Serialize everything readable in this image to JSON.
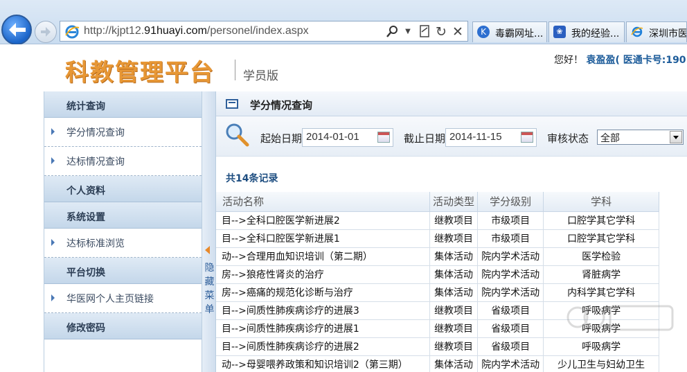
{
  "browser": {
    "url_prefix": "http://kjpt12.",
    "url_domain": "91huayi.com",
    "url_path": "/personel/index.aspx",
    "tabs": [
      {
        "label": "毒霸网址...",
        "icon": "k-icon",
        "color": "#2d6fd0"
      },
      {
        "label": "我的经验...",
        "icon": "paw-icon",
        "color": "#2a5fc0"
      },
      {
        "label": "深圳市医",
        "icon": "ie-icon",
        "color": "#1e7fd8"
      }
    ]
  },
  "header": {
    "logo": "科教管理平台",
    "edition": "学员版",
    "greeting_prefix": "您好！",
    "user_text": "袁盈盈( 医通卡号:190"
  },
  "sidebar": {
    "items": [
      {
        "type": "section",
        "label": "统计查询"
      },
      {
        "type": "item",
        "label": "学分情况查询"
      },
      {
        "type": "item",
        "label": "达标情况查询"
      },
      {
        "type": "section",
        "label": "个人资料"
      },
      {
        "type": "section",
        "label": "系统设置"
      },
      {
        "type": "item",
        "label": "达标标准浏览"
      },
      {
        "type": "section",
        "label": "平台切换"
      },
      {
        "type": "item",
        "label": "华医网个人主页链接"
      },
      {
        "type": "section",
        "label": "修改密码"
      }
    ],
    "toggle_label": "隐藏菜单"
  },
  "main": {
    "title": "学分情况查询",
    "filters": {
      "start_label": "起始日期",
      "start_value": "2014-01-01",
      "end_label": "截止日期",
      "end_value": "2014-11-15",
      "status_label": "审核状态",
      "status_value": "全部"
    },
    "record_count": "共14条记录",
    "columns": [
      "活动名称",
      "活动类型",
      "学分级别",
      "学科"
    ],
    "rows": [
      [
        "目-->全科口腔医学新进展2",
        "继教项目",
        "市级项目",
        "口腔学其它学科"
      ],
      [
        "目-->全科口腔医学新进展1",
        "继教项目",
        "市级项目",
        "口腔学其它学科"
      ],
      [
        "动-->合理用血知识培训（第二期）",
        "集体活动",
        "院内学术活动",
        "医学检验"
      ],
      [
        "房-->狼疮性肾炎的治疗",
        "集体活动",
        "院内学术活动",
        "肾脏病学"
      ],
      [
        "房-->癌痛的规范化诊断与治疗",
        "集体活动",
        "院内学术活动",
        "内科学其它学科"
      ],
      [
        "目-->间质性肺疾病诊疗的进展3",
        "继教项目",
        "省级项目",
        "呼吸病学"
      ],
      [
        "目-->间质性肺疾病诊疗的进展1",
        "继教项目",
        "省级项目",
        "呼吸病学"
      ],
      [
        "目-->间质性肺疾病诊疗的进展2",
        "继教项目",
        "省级项目",
        "呼吸病学"
      ],
      [
        "动-->母婴喂养政策和知识培训2（第三期）",
        "集体活动",
        "院内学术活动",
        "少儿卫生与妇幼卫生"
      ]
    ]
  }
}
